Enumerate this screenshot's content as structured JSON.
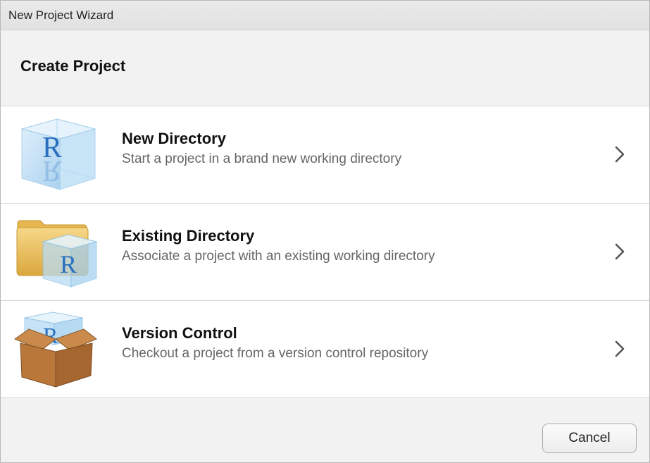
{
  "window": {
    "title": "New Project Wizard"
  },
  "header": {
    "title": "Create Project"
  },
  "options": [
    {
      "title": "New Directory",
      "description": "Start a project in a brand new working directory",
      "icon": "r-cube-icon"
    },
    {
      "title": "Existing Directory",
      "description": "Associate a project with an existing working directory",
      "icon": "folder-r-icon"
    },
    {
      "title": "Version Control",
      "description": "Checkout a project from a version control repository",
      "icon": "box-r-icon"
    }
  ],
  "footer": {
    "cancel_label": "Cancel"
  },
  "colors": {
    "r_blue": "#2a6fbf",
    "cube_blue": "#a9d3f0",
    "folder_yellow": "#e8b94a",
    "box_brown": "#b9773a"
  }
}
